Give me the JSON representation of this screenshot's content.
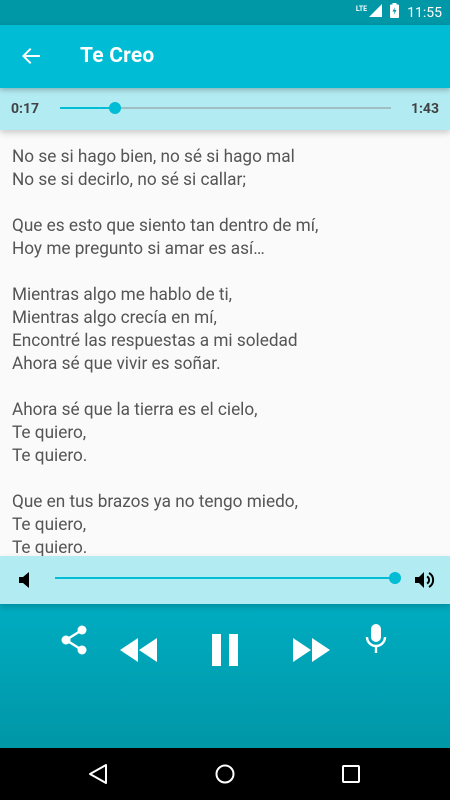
{
  "status_bar": {
    "network": "LTE",
    "time": "11:55"
  },
  "app_bar": {
    "title": "Te Creo",
    "back_icon": "arrow-back-icon"
  },
  "progress": {
    "current_time": "0:17",
    "total_time": "1:43",
    "fraction": 0.165
  },
  "lyrics": [
    [
      "No se si hago bien, no sé si hago mal",
      "No se si decirlo, no sé si callar;"
    ],
    [
      "Que es esto que siento tan dentro de mí,",
      "Hoy me pregunto si amar es así…"
    ],
    [
      "Mientras algo me hablo de ti,",
      "Mientras algo crecía en mí,",
      "Encontré las respuestas a mi soledad",
      "Ahora sé que vivir es soñar."
    ],
    [
      "Ahora sé que la tierra es el cielo,",
      "Te quiero,",
      "Te quiero."
    ],
    [
      "Que en tus brazos ya no tengo miedo,",
      "Te quiero,",
      "Te quiero."
    ]
  ],
  "volume": {
    "level": 1.0,
    "low_icon": "volume-low-icon",
    "high_icon": "volume-high-icon"
  },
  "controls": [
    "share-icon",
    "rewind-icon",
    "pause-icon",
    "fast-forward-icon",
    "microphone-icon"
  ],
  "colors": {
    "primary": "#00bcd4",
    "primary_dark": "#0097a7",
    "light_bar": "#b2ebf2"
  },
  "nav_bar": [
    "back-triangle-icon",
    "home-circle-icon",
    "recents-square-icon"
  ]
}
